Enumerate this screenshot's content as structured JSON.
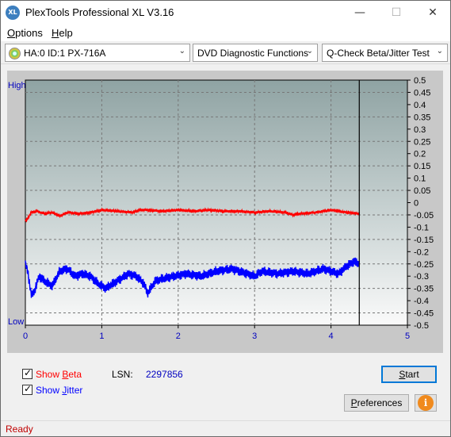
{
  "window": {
    "title": "PlexTools Professional XL V3.16",
    "app_icon_text": "XL"
  },
  "controls": {
    "minimize": "—",
    "maximize": "☐",
    "close": "✕"
  },
  "menu": [
    {
      "pre": "",
      "u": "O",
      "post": "ptions"
    },
    {
      "pre": "",
      "u": "H",
      "post": "elp"
    }
  ],
  "toolbar": {
    "drive": "HA:0 ID:1  PX-716A",
    "function": "DVD Diagnostic Functions",
    "test": "Q-Check Beta/Jitter Test",
    "arrow": "⌄"
  },
  "chart_data": {
    "type": "line",
    "y_top_label": "High",
    "y_bottom_label": "Low",
    "x_ticks": [
      "0",
      "1",
      "2",
      "3",
      "4",
      "5"
    ],
    "xlim": [
      0,
      5
    ],
    "y_right_ticks": [
      "0.5",
      "0.45",
      "0.4",
      "0.35",
      "0.3",
      "0.25",
      "0.2",
      "0.15",
      "0.1",
      "0.05",
      "0",
      "-0.05",
      "-0.1",
      "-0.15",
      "-0.2",
      "-0.25",
      "-0.3",
      "-0.35",
      "-0.4",
      "-0.45",
      "-0.5"
    ],
    "ylim": [
      -0.5,
      0.5
    ],
    "end_marker_x": 4.37,
    "grid": true,
    "series": [
      {
        "color": "#ff0000",
        "x": [
          0.0,
          0.03,
          0.08,
          0.15,
          0.25,
          0.35,
          0.45,
          0.55,
          0.7,
          0.85,
          1.0,
          1.2,
          1.4,
          1.5,
          1.6,
          1.8,
          2.0,
          2.2,
          2.4,
          2.6,
          2.8,
          3.0,
          3.2,
          3.4,
          3.5,
          3.6,
          3.8,
          4.0,
          4.1,
          4.2,
          4.37
        ],
        "y": [
          -0.075,
          -0.065,
          -0.04,
          -0.035,
          -0.045,
          -0.04,
          -0.055,
          -0.04,
          -0.045,
          -0.04,
          -0.03,
          -0.035,
          -0.04,
          -0.03,
          -0.03,
          -0.035,
          -0.03,
          -0.035,
          -0.03,
          -0.035,
          -0.035,
          -0.04,
          -0.035,
          -0.04,
          -0.05,
          -0.045,
          -0.04,
          -0.03,
          -0.035,
          -0.04,
          -0.045
        ]
      },
      {
        "color": "#0000ff",
        "x": [
          0.0,
          0.03,
          0.08,
          0.12,
          0.18,
          0.25,
          0.35,
          0.45,
          0.55,
          0.65,
          0.75,
          0.85,
          0.95,
          1.05,
          1.15,
          1.25,
          1.35,
          1.45,
          1.55,
          1.6,
          1.7,
          1.8,
          1.95,
          2.1,
          2.3,
          2.5,
          2.7,
          2.9,
          3.0,
          3.1,
          3.3,
          3.5,
          3.7,
          3.9,
          4.1,
          4.2,
          4.3,
          4.37
        ],
        "y": [
          -0.25,
          -0.28,
          -0.38,
          -0.36,
          -0.3,
          -0.32,
          -0.34,
          -0.28,
          -0.27,
          -0.3,
          -0.29,
          -0.3,
          -0.33,
          -0.35,
          -0.33,
          -0.31,
          -0.29,
          -0.3,
          -0.33,
          -0.37,
          -0.32,
          -0.31,
          -0.3,
          -0.29,
          -0.3,
          -0.28,
          -0.27,
          -0.29,
          -0.3,
          -0.28,
          -0.29,
          -0.28,
          -0.29,
          -0.27,
          -0.29,
          -0.26,
          -0.24,
          -0.25
        ]
      }
    ]
  },
  "options": {
    "show_beta_pre": "Show ",
    "show_beta_u": "B",
    "show_beta_post": "eta",
    "show_jitter_pre": "Show ",
    "show_jitter_u": "J",
    "show_jitter_post": "itter",
    "lsn_label": "LSN:",
    "lsn_value": "2297856"
  },
  "buttons": {
    "start_u": "S",
    "start_rest": "tart",
    "pref_u": "P",
    "pref_rest": "references",
    "info": "i"
  },
  "status": {
    "text": "Ready"
  },
  "colors": {
    "beta": "#ff0000",
    "jitter": "#0000ff",
    "status": "#c00000",
    "label_blue": "#0000c0"
  }
}
